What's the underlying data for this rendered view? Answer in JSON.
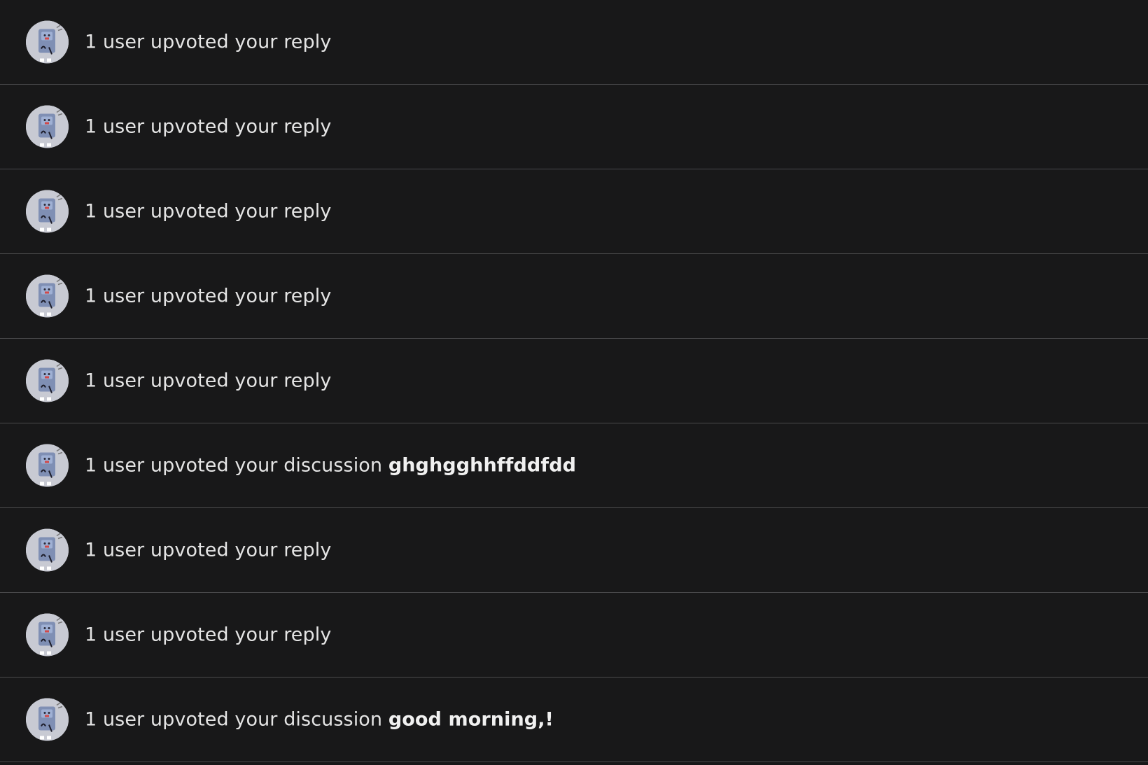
{
  "notifications": {
    "items": [
      {
        "text": "1 user upvoted your reply",
        "title": "",
        "avatar_icon": "robot-avatar-icon"
      },
      {
        "text": "1 user upvoted your reply",
        "title": "",
        "avatar_icon": "robot-avatar-icon"
      },
      {
        "text": "1 user upvoted your reply",
        "title": "",
        "avatar_icon": "robot-avatar-icon"
      },
      {
        "text": "1 user upvoted your reply",
        "title": "",
        "avatar_icon": "robot-avatar-icon"
      },
      {
        "text": "1 user upvoted your reply",
        "title": "",
        "avatar_icon": "robot-avatar-icon"
      },
      {
        "text": "1 user upvoted your discussion ",
        "title": "ghghgghhffddfdd",
        "avatar_icon": "robot-avatar-icon"
      },
      {
        "text": "1 user upvoted your reply",
        "title": "",
        "avatar_icon": "robot-avatar-icon"
      },
      {
        "text": "1 user upvoted your reply",
        "title": "",
        "avatar_icon": "robot-avatar-icon"
      },
      {
        "text": "1 user upvoted your discussion ",
        "title": "good morning,!",
        "avatar_icon": "robot-avatar-icon"
      }
    ]
  },
  "colors": {
    "background": "#181819",
    "divider": "#4a4a4c",
    "text": "#e4e4e4"
  }
}
